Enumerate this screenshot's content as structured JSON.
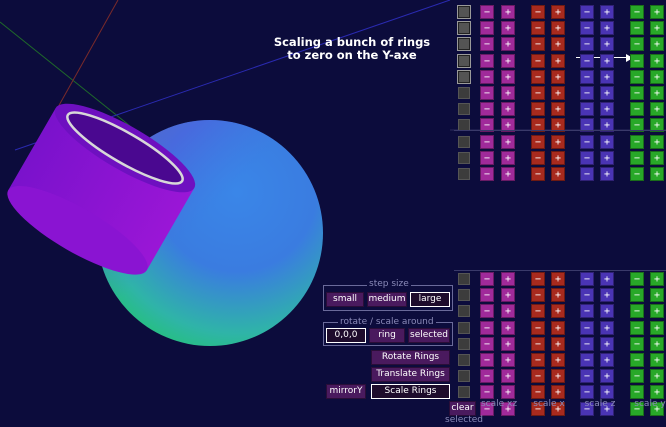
{
  "annotation": {
    "line1": "Scaling a bunch of rings",
    "line2": "to zero on the Y-axe"
  },
  "colors": {
    "background": "#0c0c3c",
    "scale_xz": "#a02a9a",
    "scale_x": "#a82a1e",
    "scale_z": "#4a34b4",
    "scale_y": "#28a828",
    "button": "#4a1a5e"
  },
  "rings": {
    "count": 20,
    "selected_rows": [
      0,
      1,
      2,
      3,
      4
    ]
  },
  "scale_columns": [
    {
      "label": "scale xz",
      "minus": "−",
      "plus": "+"
    },
    {
      "label": "scale x",
      "minus": "−",
      "plus": "+"
    },
    {
      "label": "scale z",
      "minus": "−",
      "plus": "+"
    },
    {
      "label": "scale y",
      "minus": "−",
      "plus": "+"
    }
  ],
  "step_size": {
    "label": "step size",
    "options": [
      "small",
      "medium",
      "large"
    ],
    "selected": "large"
  },
  "rotate_scale_around": {
    "label": "rotate / scale around",
    "options": [
      "0,0,0",
      "ring",
      "selected"
    ],
    "selected": "0,0,0"
  },
  "actions": {
    "rotate": "Rotate Rings",
    "translate": "Translate Rings",
    "scale": "Scale Rings",
    "mirror": "mirrorY"
  },
  "clear": {
    "button": "clear",
    "label": "selected"
  }
}
